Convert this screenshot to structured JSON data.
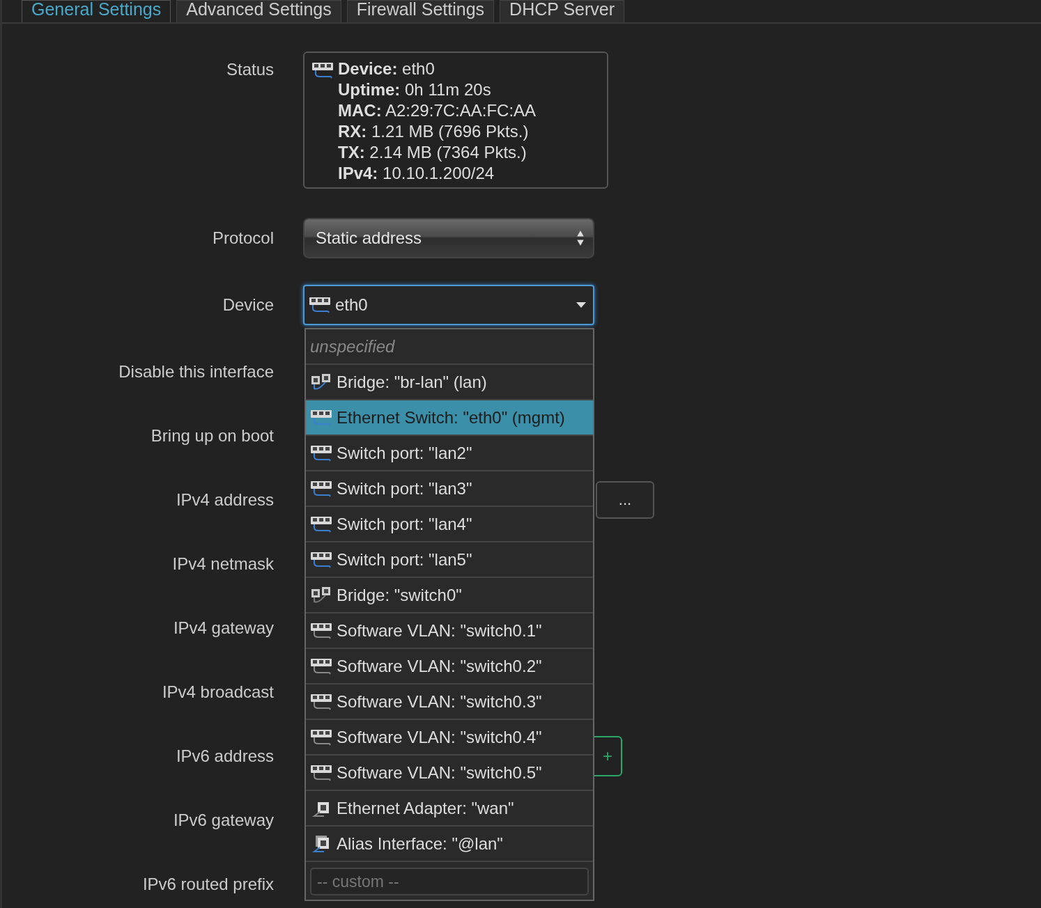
{
  "tabs": [
    {
      "label": "General Settings",
      "selected": true
    },
    {
      "label": "Advanced Settings",
      "selected": false
    },
    {
      "label": "Firewall Settings",
      "selected": false
    },
    {
      "label": "DHCP Server",
      "selected": false
    }
  ],
  "status": {
    "label": "Status",
    "lines": [
      "**Device:** eth0",
      "**Uptime:** 0h 11m 20s",
      "**MAC:** A2:29:7C:AA:FC:AA",
      "**RX:** 1.21 MB (7696 Pkts.)",
      "**TX:** 2.14 MB (7364 Pkts.)",
      "**IPv4:** 10.10.1.200/24"
    ]
  },
  "protocol": {
    "label": "Protocol",
    "value": "Static address"
  },
  "device": {
    "label": "Device",
    "value": "eth0",
    "expanded": true,
    "options": [
      {
        "kind": "placeholder",
        "label": "unspecified",
        "selected": false
      },
      {
        "kind": "bridge",
        "label": "Bridge: \"br-lan\" (lan)",
        "selected": false
      },
      {
        "kind": "switch",
        "label": "Ethernet Switch: \"eth0\" (mgmt)",
        "selected": true
      },
      {
        "kind": "switch",
        "label": "Switch port: \"lan2\"",
        "selected": false
      },
      {
        "kind": "switch",
        "label": "Switch port: \"lan3\"",
        "selected": false
      },
      {
        "kind": "switch",
        "label": "Switch port: \"lan4\"",
        "selected": false
      },
      {
        "kind": "switch",
        "label": "Switch port: \"lan5\"",
        "selected": false
      },
      {
        "kind": "bridge-inactive",
        "label": "Bridge: \"switch0\"",
        "selected": false
      },
      {
        "kind": "vlan",
        "label": "Software VLAN: \"switch0.1\"",
        "selected": false
      },
      {
        "kind": "vlan",
        "label": "Software VLAN: \"switch0.2\"",
        "selected": false
      },
      {
        "kind": "vlan",
        "label": "Software VLAN: \"switch0.3\"",
        "selected": false
      },
      {
        "kind": "vlan",
        "label": "Software VLAN: \"switch0.4\"",
        "selected": false
      },
      {
        "kind": "vlan",
        "label": "Software VLAN: \"switch0.5\"",
        "selected": false
      },
      {
        "kind": "adapter",
        "label": "Ethernet Adapter: \"wan\"",
        "selected": false
      },
      {
        "kind": "alias",
        "label": "Alias Interface: \"@lan\"",
        "selected": false
      }
    ],
    "custom": {
      "placeholder": "-- custom --"
    }
  },
  "fields": [
    {
      "label": "Disable this interface"
    },
    {
      "label": "Bring up on boot"
    },
    {
      "label": "IPv4 address",
      "button": "..."
    },
    {
      "label": "IPv4 netmask"
    },
    {
      "label": "IPv4 gateway"
    },
    {
      "label": "IPv4 broadcast"
    },
    {
      "label": "IPv6 address",
      "button": "+"
    },
    {
      "label": "IPv6 gateway"
    },
    {
      "label": "IPv6 routed prefix"
    }
  ]
}
